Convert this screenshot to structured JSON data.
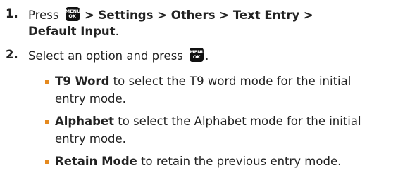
{
  "steps": [
    {
      "number": "1.",
      "pre": "Press",
      "path_line1": "> Settings > Others > Text Entry >",
      "path_line2": "Default Input",
      "post": "."
    },
    {
      "number": "2.",
      "text": "Select an option and press",
      "post": "."
    }
  ],
  "key_icon": {
    "name": "menu-ok-key-icon",
    "line1": "MENU",
    "line2": "OK"
  },
  "options": [
    {
      "label": "T9 Word",
      "line1": "to select the T9 word mode for the initial",
      "line2": "entry mode."
    },
    {
      "label": "Alphabet",
      "line1": "to select the Alphabet mode for the initial",
      "line2": "entry mode."
    },
    {
      "label": "Retain Mode",
      "line1": "to retain the previous entry mode.",
      "line2": ""
    }
  ],
  "colors": {
    "bullet": "#e58a1f",
    "text": "#222222",
    "key_bg": "#111111"
  }
}
